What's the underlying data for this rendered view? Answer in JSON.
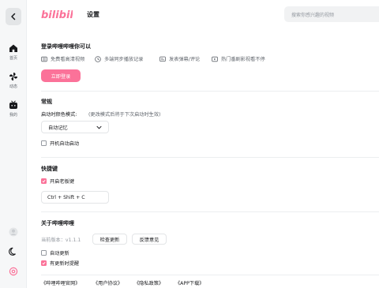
{
  "app": {
    "logo_text": "bilibili",
    "page_title": "设置",
    "search_placeholder": "搜索你感兴趣的视频",
    "brand_color": "#fb7299"
  },
  "sidebar": {
    "back_icon": "chevron-left-icon",
    "items": [
      {
        "label": "首页",
        "icon": "home-icon"
      },
      {
        "label": "动态",
        "icon": "pinwheel-icon"
      },
      {
        "label": "我的",
        "icon": "tv-icon"
      }
    ],
    "bottom_icons": [
      "avatar-icon",
      "moon-icon",
      "settings-icon"
    ]
  },
  "login": {
    "title": "登录哔哩哔哩你可以",
    "features": [
      {
        "label": "免费看高清视频",
        "icon": "hd-icon"
      },
      {
        "label": "多端同步播放记录",
        "icon": "clock-icon"
      },
      {
        "label": "发表弹幕/评论",
        "icon": "danmaku-icon"
      },
      {
        "label": "热门番剧影视看不停",
        "icon": "play-icon"
      }
    ],
    "button": "立即登录"
  },
  "general": {
    "title": "常规",
    "theme_label": "启动时颜色模式:",
    "theme_hint": "(更改模式后将于下次启动时生效)",
    "theme_value": "自动记忆",
    "autostart_label": "开机自动启动",
    "autostart_checked": false
  },
  "hotkey": {
    "title": "快捷键",
    "boss_key_label": "开启老板键",
    "boss_key_checked": true,
    "combo": "Ctrl + Shift + C"
  },
  "about": {
    "title": "关于哔哩哔哩",
    "version": "当前版本：v1.1.1",
    "check_update": "检查更新",
    "feedback": "反馈意见",
    "auto_update_label": "自动更新",
    "auto_update_checked": false,
    "update_notify_label": "有更新时提醒",
    "update_notify_checked": true
  },
  "links": [
    "《哔哩哔哩官网》",
    "《用户协议》",
    "《隐私政策》",
    "《APP下载》"
  ]
}
